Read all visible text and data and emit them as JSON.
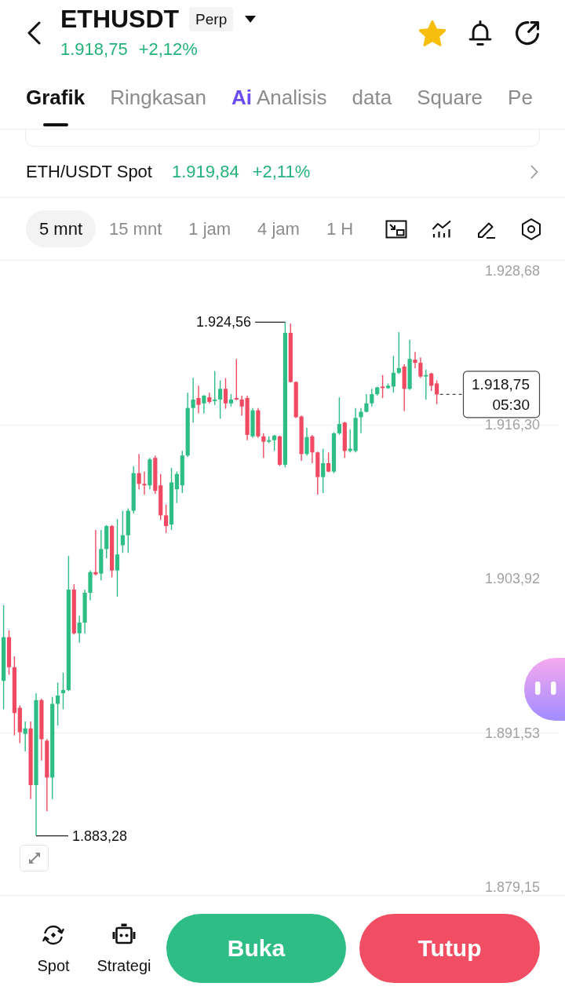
{
  "header": {
    "symbol": "ETHUSDT",
    "contract_type": "Perp",
    "price": "1.918,75",
    "change": "+2,12%",
    "favorite": true
  },
  "tabs": [
    {
      "label": "Grafik",
      "selected": true
    },
    {
      "label": "Ringkasan",
      "selected": false
    },
    {
      "badge": "Ai",
      "label": "Analisis",
      "selected": false
    },
    {
      "label": "data",
      "selected": false
    },
    {
      "label": "Square",
      "selected": false
    },
    {
      "label": "Pe",
      "selected": false
    }
  ],
  "spot_ticker": {
    "pair": "ETH/USDT Spot",
    "price": "1.919,84",
    "change": "+2,11%"
  },
  "intervals": [
    {
      "label": "5 mnt",
      "selected": true
    },
    {
      "label": "15 mnt",
      "selected": false
    },
    {
      "label": "1 jam",
      "selected": false
    },
    {
      "label": "4 jam",
      "selected": false
    },
    {
      "label": "1 H",
      "selected": false
    }
  ],
  "chart": {
    "chart_data": {
      "type": "candlestick",
      "ohlc": [
        [
          1895.73,
          1901.82,
          1893.44,
          1899.24
        ],
        [
          1899.24,
          1899.79,
          1896.22,
          1896.83
        ],
        [
          1896.83,
          1897.7,
          1891.35,
          1893.14
        ],
        [
          1893.57,
          1893.75,
          1890.73,
          1891.6
        ],
        [
          1891.47,
          1892.46,
          1890.06,
          1891.91
        ],
        [
          1891.91,
          1892.46,
          1886.24,
          1887.35
        ],
        [
          1887.35,
          1894.74,
          1883.28,
          1894.18
        ],
        [
          1894.18,
          1894.3,
          1889.32,
          1891.04
        ],
        [
          1890.92,
          1891.04,
          1885.25,
          1887.96
        ],
        [
          1887.96,
          1894.43,
          1886.24,
          1893.88
        ],
        [
          1893.88,
          1895.6,
          1892.15,
          1894.55
        ],
        [
          1894.74,
          1896.4,
          1893.44,
          1894.99
        ],
        [
          1894.99,
          1905.77,
          1894.9,
          1903.06
        ],
        [
          1903.06,
          1903.49,
          1899.45,
          1899.55
        ],
        [
          1899.55,
          1900.96,
          1898.81,
          1900.41
        ],
        [
          1900.41,
          1903.06,
          1899.55,
          1902.81
        ],
        [
          1902.81,
          1904.6,
          1902.19,
          1904.47
        ],
        [
          1904.47,
          1907.86,
          1904.2,
          1904.29
        ],
        [
          1904.35,
          1907.86,
          1903.8,
          1906.32
        ],
        [
          1906.32,
          1908.25,
          1905.58,
          1908.17
        ],
        [
          1908.17,
          1908.25,
          1904.04,
          1904.6
        ],
        [
          1904.6,
          1908.73,
          1902.5,
          1905.89
        ],
        [
          1906.63,
          1909.4,
          1906.01,
          1907.43
        ],
        [
          1907.43,
          1909.59,
          1906.01,
          1909.4
        ],
        [
          1909.4,
          1912.98,
          1909.16,
          1912.42
        ],
        [
          1912.42,
          1913.96,
          1911.13,
          1911.56
        ],
        [
          1911.56,
          1912.55,
          1910.7,
          1911.44
        ],
        [
          1911.44,
          1913.65,
          1911.13,
          1913.53
        ],
        [
          1913.65,
          1913.84,
          1910.76,
          1911.0
        ],
        [
          1911.44,
          1912.36,
          1908.66,
          1909.03
        ],
        [
          1909.03,
          1909.9,
          1907.62,
          1908.17
        ],
        [
          1908.29,
          1912.85,
          1907.86,
          1911.68
        ],
        [
          1911.13,
          1912.55,
          1910.02,
          1912.36
        ],
        [
          1911.44,
          1914.21,
          1910.82,
          1913.84
        ],
        [
          1913.84,
          1918.89,
          1913.72,
          1917.66
        ],
        [
          1917.66,
          1920.06,
          1916.49,
          1918.34
        ],
        [
          1918.46,
          1919.45,
          1917.23,
          1917.91
        ],
        [
          1918.03,
          1918.7,
          1917.23,
          1918.65
        ],
        [
          1918.52,
          1918.89,
          1918.03,
          1918.15
        ],
        [
          1918.21,
          1920.62,
          1917.91,
          1918.34
        ],
        [
          1918.34,
          1919.88,
          1916.8,
          1919.2
        ],
        [
          1919.2,
          1920.06,
          1917.6,
          1918.03
        ],
        [
          1918.03,
          1918.77,
          1917.78,
          1918.34
        ],
        [
          1918.46,
          1921.6,
          1918.28,
          1918.34
        ],
        [
          1918.34,
          1918.65,
          1917.04,
          1917.78
        ],
        [
          1918.46,
          1918.65,
          1915.07,
          1915.5
        ],
        [
          1915.38,
          1917.66,
          1915.26,
          1917.47
        ],
        [
          1917.47,
          1917.66,
          1915.26,
          1915.38
        ],
        [
          1915.38,
          1915.63,
          1913.65,
          1914.95
        ],
        [
          1914.95,
          1915.38,
          1914.83,
          1915.07
        ],
        [
          1915.07,
          1915.5,
          1914.21,
          1915.44
        ],
        [
          1915.38,
          1915.44,
          1913.0,
          1913.1
        ],
        [
          1913.1,
          1924.56,
          1912.9,
          1923.7
        ],
        [
          1923.7,
          1924.44,
          1919.7,
          1919.75
        ],
        [
          1919.75,
          1919.8,
          1916.85,
          1916.92
        ],
        [
          1916.98,
          1917.05,
          1913.41,
          1913.96
        ],
        [
          1913.96,
          1916.06,
          1913.84,
          1915.32
        ],
        [
          1915.38,
          1915.5,
          1913.22,
          1914.09
        ],
        [
          1914.09,
          1914.15,
          1910.7,
          1912.11
        ],
        [
          1912.11,
          1914.39,
          1910.82,
          1913.22
        ],
        [
          1913.22,
          1914.09,
          1912.5,
          1912.55
        ],
        [
          1912.55,
          1915.7,
          1912.42,
          1915.63
        ],
        [
          1915.63,
          1918.52,
          1915.5,
          1916.37
        ],
        [
          1916.49,
          1916.55,
          1913.65,
          1914.21
        ],
        [
          1914.21,
          1915.93,
          1914.09,
          1914.39
        ],
        [
          1914.21,
          1917.66,
          1914.09,
          1916.86
        ],
        [
          1916.92,
          1917.66,
          1915.63,
          1917.35
        ],
        [
          1917.35,
          1918.77,
          1917.3,
          1918.03
        ],
        [
          1918.03,
          1919.2,
          1917.78,
          1918.77
        ],
        [
          1918.77,
          1919.35,
          1918.65,
          1919.32
        ],
        [
          1919.38,
          1920.31,
          1918.46,
          1919.26
        ],
        [
          1919.26,
          1919.63,
          1919.2,
          1919.45
        ],
        [
          1919.38,
          1921.85,
          1918.89,
          1920.49
        ],
        [
          1920.49,
          1923.76,
          1920.4,
          1920.86
        ],
        [
          1920.99,
          1921.17,
          1917.41,
          1919.2
        ],
        [
          1919.2,
          1923.14,
          1919.1,
          1921.6
        ],
        [
          1921.54,
          1922.16,
          1920.86,
          1921.29
        ],
        [
          1921.29,
          1921.73,
          1920.06,
          1920.19
        ],
        [
          1920.19,
          1920.74,
          1918.34,
          1920.31
        ],
        [
          1920.43,
          1920.5,
          1919.02,
          1919.45
        ],
        [
          1919.63,
          1919.88,
          1917.97,
          1918.75
        ]
      ],
      "ylim": [
        1879.15,
        1928.68
      ],
      "yticks": [
        {
          "value": 1928.68,
          "label": "1.928,68"
        },
        {
          "value": 1916.3,
          "label": "1.916,30"
        },
        {
          "value": 1903.92,
          "label": "1.903,92"
        },
        {
          "value": 1891.53,
          "label": "1.891,53"
        },
        {
          "value": 1879.15,
          "label": "1.879,15"
        }
      ]
    },
    "high_label": "1.924,56",
    "low_label": "1.883,28",
    "last_price": "1.918,75",
    "countdown": "05:30"
  },
  "bottom_nav": [
    {
      "label": "Spot",
      "kind": "spot"
    },
    {
      "label": "Strategi",
      "kind": "bot"
    }
  ],
  "actions": [
    {
      "label": "Buka",
      "kind": "open"
    },
    {
      "label": "Tutup",
      "kind": "close"
    }
  ]
}
